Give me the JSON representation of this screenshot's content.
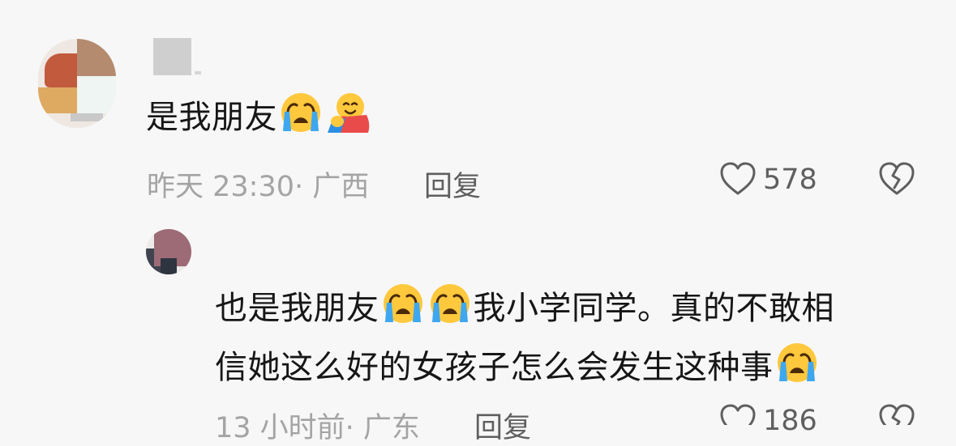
{
  "comments": [
    {
      "text_parts": [
        "是我朋友",
        ""
      ],
      "emojis": [
        "crying-face",
        "hug-face"
      ],
      "time": "昨天 23:30",
      "location": "· 广西",
      "reply_label": "回复",
      "likes": "578"
    },
    {
      "line1_a": "也是我朋友",
      "line1_b": "我小学同学。真的不敢相",
      "line2": "信她这么好的女孩子怎么会发生这种事",
      "emojis": [
        "crying-face",
        "crying-face",
        "crying-face"
      ],
      "time": "13 小时前",
      "location": "· 广东",
      "reply_label": "回复",
      "likes": "186"
    }
  ],
  "icons": {
    "like": "heart-outline-icon",
    "dislike": "broken-heart-icon"
  },
  "colors": {
    "background": "#f7f7f7",
    "text": "#161616",
    "meta": "#a4a4a4",
    "secondary": "#5f5f5f"
  }
}
